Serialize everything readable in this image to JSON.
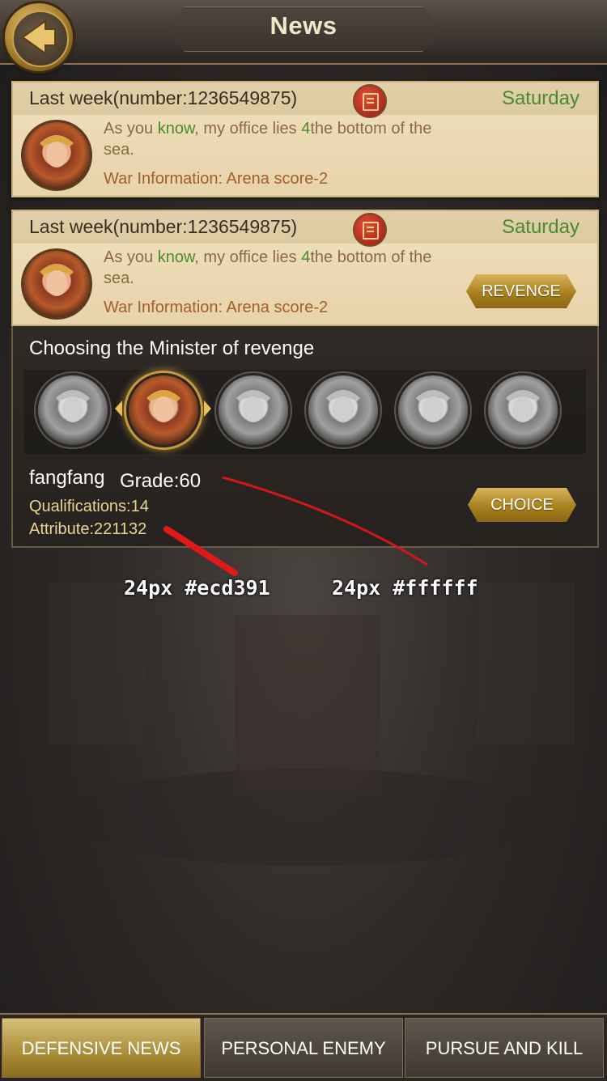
{
  "header": {
    "title": "News",
    "back_icon": "back-arrow-icon"
  },
  "news_items": [
    {
      "title": "Last week(number:1236549875)",
      "day": "Saturday",
      "message_parts": [
        "As you ",
        "know",
        ", my office lies ",
        "4",
        "the bottom of the sea."
      ],
      "war_info": "War Information:  Arena score-2"
    },
    {
      "title": "Last week(number:1236549875)",
      "day": "Saturday",
      "message_parts": [
        "As you ",
        "know",
        ", my office lies ",
        "4",
        "the bottom of the sea."
      ],
      "war_info": "War Information:  Arena score-2",
      "action_label": "REVENGE"
    }
  ],
  "revenge_panel": {
    "title": "Choosing the Minister of revenge",
    "selected_index": 1,
    "minister_count": 6,
    "minister": {
      "name": "fangfang",
      "grade": "Grade:60",
      "qualifications": "Qualifications:14",
      "attribute": "Attribute:221132"
    },
    "choice_label": "CHOICE"
  },
  "annotations": {
    "left": "24px #ecd391",
    "right": "24px #ffffff"
  },
  "tabs": [
    {
      "label": "DEFENSIVE NEWS",
      "active": true
    },
    {
      "label": "PERSONAL ENEMY",
      "active": false
    },
    {
      "label": "PURSUE AND KILL",
      "active": false
    }
  ],
  "colors": {
    "accent_gold": "#ecd391",
    "text_white": "#ffffff",
    "day_green": "#4c8a2f",
    "war_brown": "#a45e2a"
  }
}
